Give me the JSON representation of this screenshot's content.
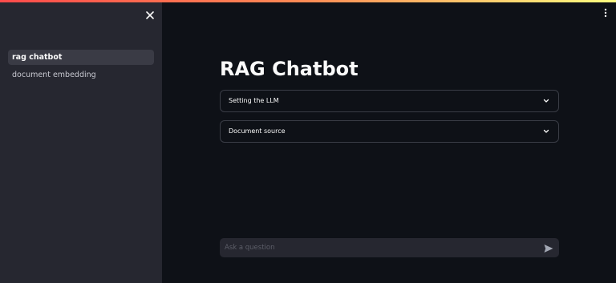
{
  "sidebar": {
    "items": [
      {
        "label": "rag chatbot",
        "active": true
      },
      {
        "label": "document embedding",
        "active": false
      }
    ]
  },
  "main": {
    "title": "RAG Chatbot",
    "expanders": [
      {
        "label": "Setting the LLM"
      },
      {
        "label": "Document source"
      }
    ],
    "chat": {
      "placeholder": "Ask a question"
    }
  },
  "icons": {
    "close": "close-icon",
    "menu": "kebab-menu-icon",
    "chevron": "chevron-down-icon",
    "send": "send-icon"
  },
  "colors": {
    "background": "#0e1117",
    "sidebar": "#262730",
    "accent": "#ff4b4b"
  }
}
